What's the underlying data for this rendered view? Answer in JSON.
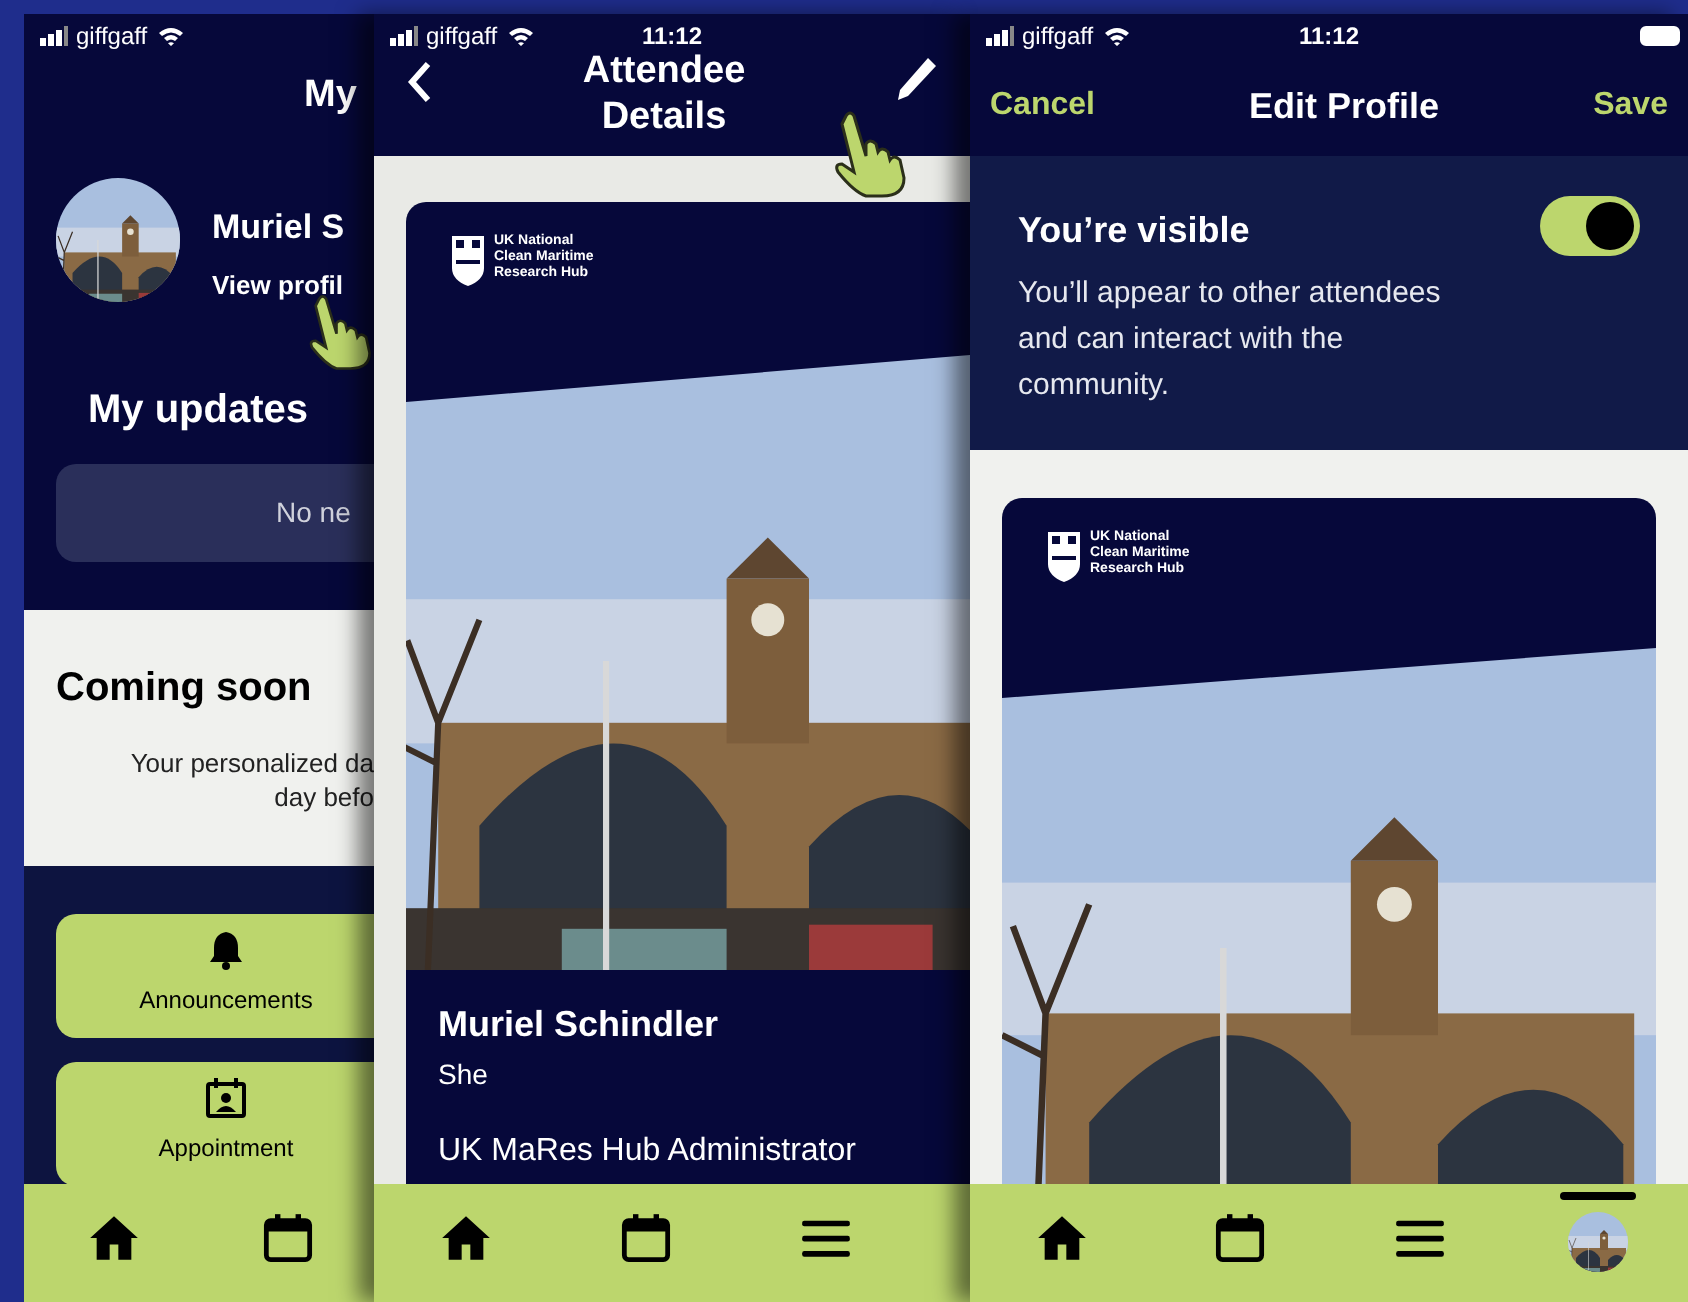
{
  "home_screen": {
    "status": {
      "carrier": "giffgaff"
    },
    "title": "My",
    "profile": {
      "name": "Muriel S",
      "link": "View profil"
    },
    "updates": {
      "heading": "My updates",
      "empty_text": "No ne"
    },
    "coming_soon": {
      "heading": "Coming soon",
      "lines": [
        "Your personalized da",
        "day befo"
      ]
    },
    "shortcuts": [
      {
        "kind": "bell",
        "label": "Announcements"
      },
      {
        "kind": "appointment",
        "label": "Appointment"
      }
    ],
    "tab_bar": [
      {
        "kind": "home"
      },
      {
        "kind": "calendar"
      }
    ]
  },
  "attendee_screen": {
    "status": {
      "carrier": "giffgaff",
      "time": "11:12"
    },
    "title_lines": [
      "Attendee",
      "Details"
    ],
    "card": {
      "logo_lines": [
        "UK National",
        "Clean Maritime",
        "Research Hub"
      ],
      "name": "Muriel Schindler",
      "pronoun": "She",
      "role": "UK MaRes Hub Administrator"
    },
    "tab_bar": [
      {
        "kind": "home"
      },
      {
        "kind": "calendar"
      },
      {
        "kind": "menu"
      }
    ]
  },
  "edit_screen": {
    "status": {
      "carrier": "giffgaff",
      "time": "11:12"
    },
    "cancel": "Cancel",
    "title": "Edit Profile",
    "save": "Save",
    "visibility": {
      "heading": "You’re visible",
      "description": "You’ll appear to other attendees and can interact with the community.",
      "on": true
    },
    "card": {
      "logo_lines": [
        "UK National",
        "Clean Maritime",
        "Research Hub"
      ]
    },
    "tab_bar": [
      {
        "kind": "home",
        "selected": false
      },
      {
        "kind": "calendar",
        "selected": false
      },
      {
        "kind": "menu",
        "selected": false
      },
      {
        "kind": "avatar",
        "selected": true
      }
    ]
  }
}
